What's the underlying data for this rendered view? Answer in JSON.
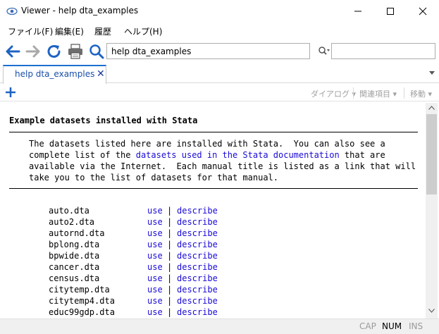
{
  "window": {
    "title": "Viewer - help dta_examples"
  },
  "menu": {
    "items": [
      "ファイル(F)",
      "編集(E)",
      "履歴",
      "ヘルプ(H)"
    ]
  },
  "toolbar": {
    "address": "help dta_examples",
    "search_value": ""
  },
  "tabs": [
    {
      "label": "help dta_examples"
    }
  ],
  "subtoolbar": {
    "dialog": "ダイアログ",
    "related": "関連項目",
    "move": "移動"
  },
  "content": {
    "heading": "Example datasets installed with Stata",
    "para_line1": "The datasets listed here are installed with Stata.  You can also see a",
    "para_line2a": "complete list of the ",
    "para_link": "datasets used in the Stata documentation",
    "para_line2b": " that are",
    "para_line3": "available via the Internet.  Each manual title is listed as a link that will",
    "para_line4": "take you to the list of datasets for that manual.",
    "use_label": "use",
    "separator": "|",
    "describe_label": "describe",
    "datasets": [
      "auto.dta",
      "auto2.dta",
      "autornd.dta",
      "bplong.dta",
      "bpwide.dta",
      "cancer.dta",
      "census.dta",
      "citytemp.dta",
      "citytemp4.dta",
      "educ99gdp.dta"
    ]
  },
  "status": {
    "cap": "CAP",
    "num": "NUM",
    "ins": "INS"
  },
  "colors": {
    "link": "#1a0ad6",
    "accent": "#1c6fd1",
    "icon_blue": "#1e63c4"
  },
  "icons": [
    "eye-icon",
    "minimize-icon",
    "maximize-icon",
    "close-icon",
    "back-arrow-icon",
    "forward-arrow-icon",
    "refresh-icon",
    "print-icon",
    "search-icon",
    "plus-icon"
  ]
}
